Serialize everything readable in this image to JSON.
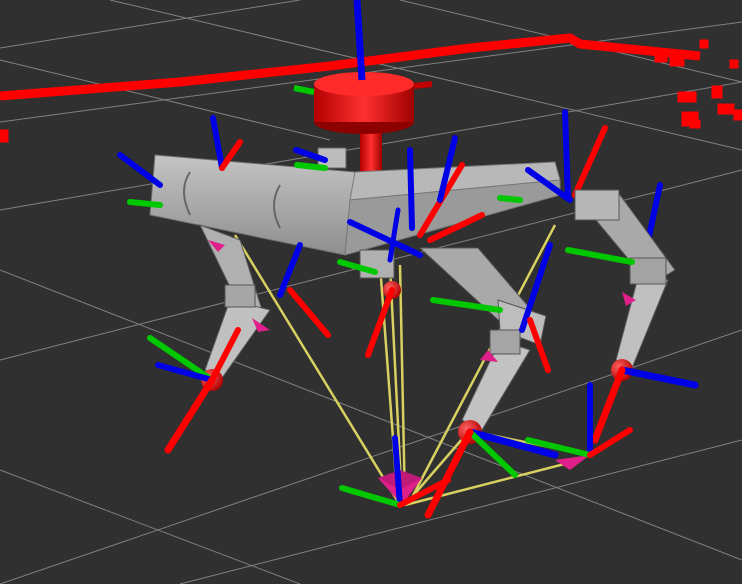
{
  "viewport": {
    "background": "#303030",
    "grid_color": "#8a8a8a",
    "laser_scan_color": "#ff0000",
    "axis_colors": {
      "x": "#ff0000",
      "y": "#00c800",
      "z": "#0000e6"
    },
    "body_color": "#a8a8a8",
    "sensor_color": "#e60000",
    "contact_line_color": "#d8d060",
    "marker_color": "#e0208a"
  }
}
